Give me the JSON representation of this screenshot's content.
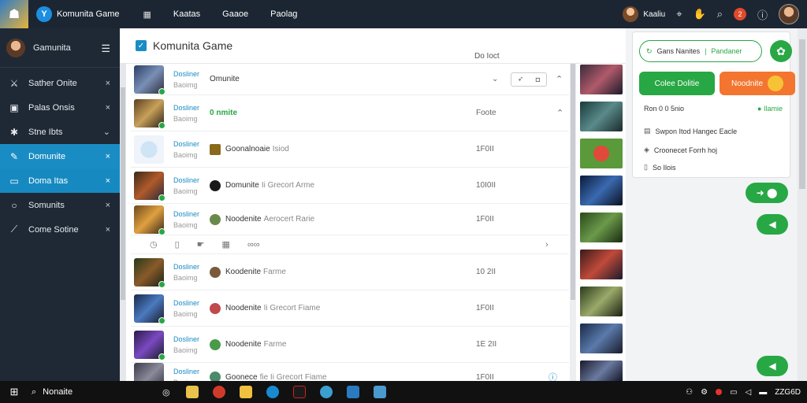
{
  "topbar": {
    "app_title": "Komunita Game",
    "app_icon_letter": "Y",
    "menu": [
      "Kaatas",
      "Gaaoe",
      "Paolag"
    ],
    "user_name": "Kaaliu",
    "notif_count": "2"
  },
  "sidebar": {
    "user_name": "Gamunita",
    "items": [
      {
        "label": "Sather Onite",
        "action": "×"
      },
      {
        "label": "Palas Onsis",
        "action": "×"
      },
      {
        "label": "Stne Ibts",
        "action": "⌄"
      },
      {
        "label": "Domunite",
        "action": "×"
      },
      {
        "label": "Doma Itas",
        "action": "×"
      },
      {
        "label": "Somunits",
        "action": "×"
      },
      {
        "label": "Come Sotine",
        "action": "×"
      }
    ]
  },
  "main": {
    "title": "Komunita Game",
    "meta": "Do  Ioct",
    "rows": [
      {
        "a": "Dosliner",
        "b": "Baoimg",
        "title": "Omunite",
        "sub": "",
        "time": "",
        "green": false
      },
      {
        "a": "Dosliner",
        "b": "Baoimg",
        "title": "0 nmite",
        "sub": "",
        "time": "Foote",
        "green": true
      },
      {
        "a": "Dosliner",
        "b": "Baoimg",
        "title": "Goonalnoaie",
        "sub": "Isiod",
        "time": "1F0II",
        "green": false
      },
      {
        "a": "Dosliner",
        "b": "Baoimg",
        "title": "Domunite",
        "sub": "Ii Grecort Arme",
        "time": "10I0II",
        "green": false
      },
      {
        "a": "Dosliner",
        "b": "Baoimg",
        "title": "Noodenite",
        "sub": "Aerocert Rarie",
        "time": "1F0II",
        "green": false
      },
      {
        "a": "Dosliner",
        "b": "Baoimg",
        "title": "Koodenite",
        "sub": "Farme",
        "time": "10 2II",
        "green": false
      },
      {
        "a": "Dosliner",
        "b": "Baoimg",
        "title": "Noodenite",
        "sub": "Ii Grecort Fiame",
        "time": "1F0II",
        "green": false
      },
      {
        "a": "Dosliner",
        "b": "Baoimg",
        "title": "Noodenite",
        "sub": "Farme",
        "time": "1E 2II",
        "green": false
      },
      {
        "a": "Dosliner",
        "b": "Baoimg",
        "title": "Goonece",
        "sub": "fie Ii Grecort Fiame",
        "time": "1F0II",
        "green": false
      }
    ],
    "controls_label": "∞∞"
  },
  "rpanel": {
    "search_label": "Gans Nanites",
    "search_alt": "Pandaner",
    "btn_primary": "Colee Dolitie",
    "btn_secondary": "Noodnite",
    "status_line": "Ron 0 0 5nio",
    "status_badge": "Ilamie",
    "line1": "Swpon Itod Hangec Eacle",
    "line2": "Croonecet Forrh hoj",
    "line3": "So Ilois"
  },
  "taskbar": {
    "search": "Nonaite",
    "clock": "ZZG6D"
  },
  "colors": {
    "accent": "#1a8cc4",
    "green": "#27a844",
    "orange": "#f3752f",
    "sidebar_bg": "#1e2935"
  }
}
